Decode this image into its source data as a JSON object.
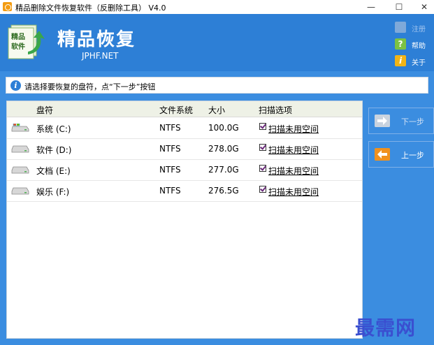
{
  "window": {
    "title": "精品删除文件恢复软件（反删除工具） V4.0",
    "minimize": "—",
    "maximize": "☐",
    "close": "✕"
  },
  "header": {
    "brand_title": "精品恢复",
    "brand_sub": "JPHF.NET",
    "logo_text": "精品软件",
    "links": [
      {
        "label": "注册",
        "icon": "register-icon",
        "enabled": false
      },
      {
        "label": "帮助",
        "icon": "help-icon",
        "enabled": true
      },
      {
        "label": "关于",
        "icon": "about-icon",
        "enabled": true
      }
    ]
  },
  "hint": {
    "text": "请选择要恢复的盘符，点“下一步”按钮"
  },
  "table": {
    "columns": [
      "盘符",
      "文件系统",
      "大小",
      "扫描选项"
    ],
    "rows": [
      {
        "drive": "系统 (C:)",
        "fs": "NTFS",
        "size": "100.0G",
        "option": "扫描未用空间",
        "checked": true,
        "icon": "windows-drive-icon"
      },
      {
        "drive": "软件 (D:)",
        "fs": "NTFS",
        "size": "278.0G",
        "option": "扫描未用空间",
        "checked": true,
        "icon": "drive-icon"
      },
      {
        "drive": "文档 (E:)",
        "fs": "NTFS",
        "size": "277.0G",
        "option": "扫描未用空间",
        "checked": true,
        "icon": "drive-icon"
      },
      {
        "drive": "娱乐 (F:)",
        "fs": "NTFS",
        "size": "276.5G",
        "option": "扫描未用空间",
        "checked": true,
        "icon": "drive-icon"
      }
    ]
  },
  "nav": {
    "next_label": "下一步",
    "prev_label": "上一步"
  },
  "watermark": "最需网",
  "colors": {
    "background": "#3b8de0",
    "header": "#2d7fd6",
    "accent_orange": "#f0911e"
  }
}
